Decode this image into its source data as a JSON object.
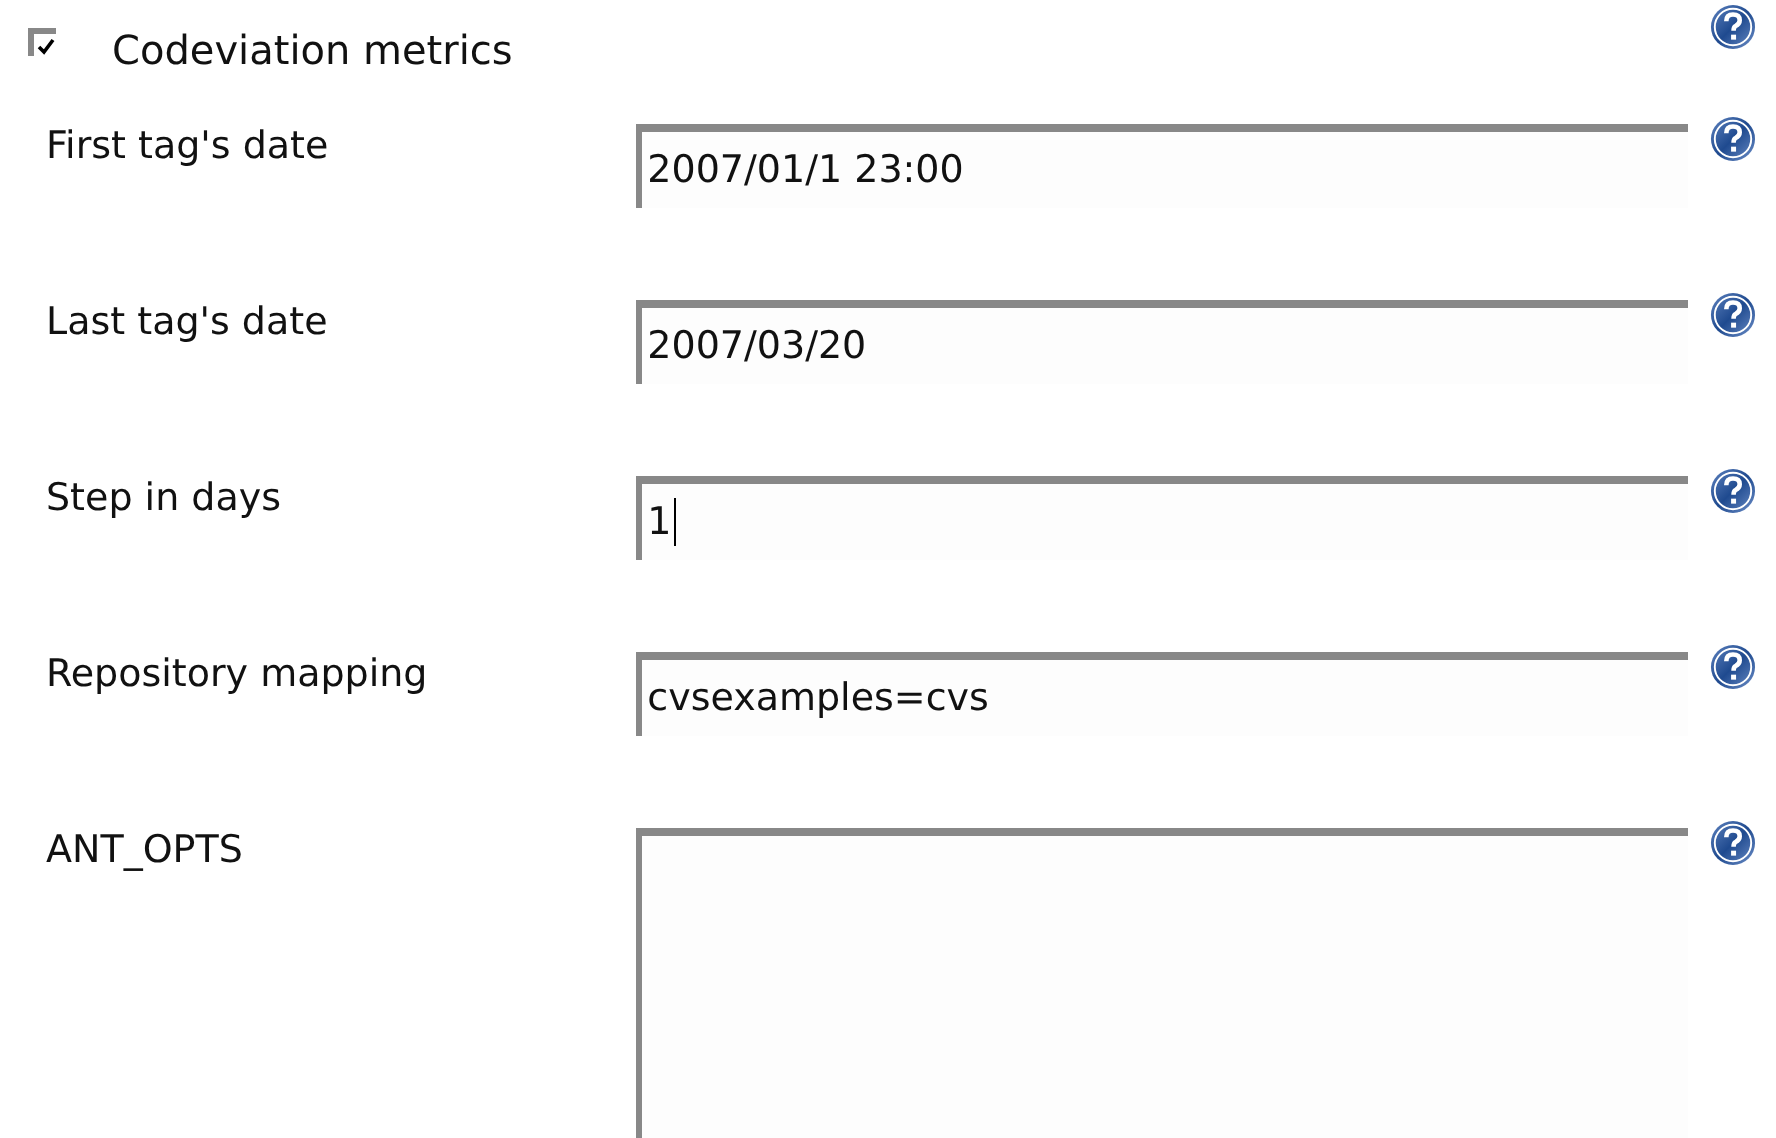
{
  "section": {
    "label": "Codeviation metrics",
    "checked": true
  },
  "fields": [
    {
      "kind": "text",
      "label": "First tag's date",
      "value": "2007/01/1 23:00",
      "focused": false
    },
    {
      "kind": "text",
      "label": "Last tag's date",
      "value": "2007/03/20",
      "focused": false
    },
    {
      "kind": "text",
      "label": "Step in days",
      "value": "1",
      "focused": true
    },
    {
      "kind": "text",
      "label": "Repository mapping",
      "value": "cvsexamples=cvs",
      "focused": false
    },
    {
      "kind": "textarea",
      "label": "ANT_OPTS",
      "focused": false
    }
  ]
}
